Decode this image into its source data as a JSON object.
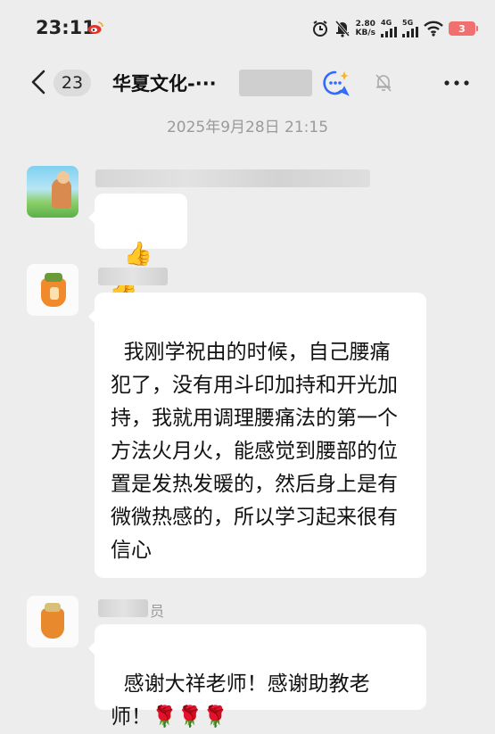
{
  "status_bar": {
    "time": "23:11",
    "net_speed_value": "2.80",
    "net_speed_unit": "KB/s",
    "signal1": "4G",
    "signal2": "5G",
    "battery": "3"
  },
  "nav": {
    "unread_count": "23",
    "title": "华夏文化-···"
  },
  "timestamp": "2025年9月28日 21:15",
  "messages": [
    {
      "sender": "",
      "text": "👍👍"
    },
    {
      "sender": "",
      "text": "我刚学祝由的时候，自己腰痛犯了，没有用斗印加持和开光加持，我就用调理腰痛法的第一个方法火月火，能感觉到腰部的位置是发热发暖的，然后身上是有微微热感的，所以学习起来很有信心"
    },
    {
      "sender": "员",
      "text": "感谢大祥老师！感谢助教老师！🌹🌹🌹"
    }
  ],
  "colors": {
    "background": "#ededed",
    "bubble": "#ffffff",
    "timestamp": "#9a9a9a"
  }
}
